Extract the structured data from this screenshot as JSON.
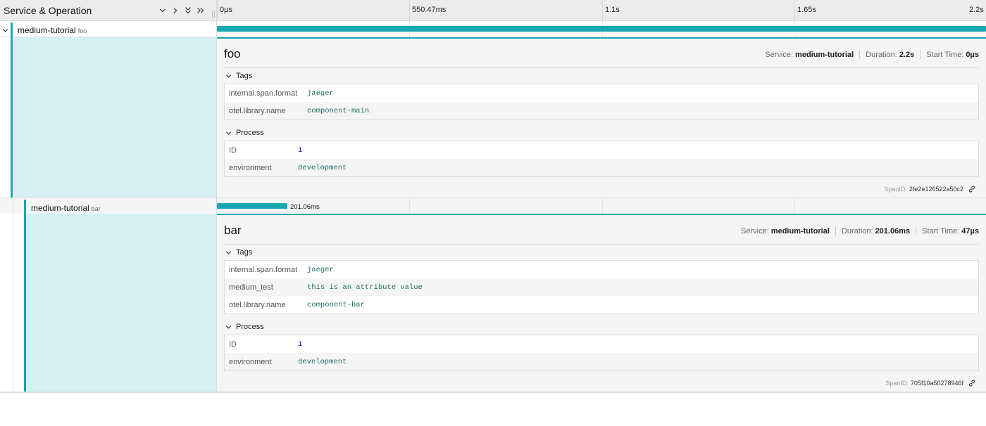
{
  "header": {
    "title": "Service & Operation",
    "controls": [
      "chevron-down-icon",
      "chevron-right-icon",
      "double-chevron-down-icon",
      "double-chevron-right-icon"
    ],
    "ticks": [
      "0µs",
      "550.47ms",
      "1.1s",
      "1.65s",
      "2.2s"
    ]
  },
  "spans": [
    {
      "service": "medium-tutorial",
      "operation": "foo",
      "duration_label": "",
      "bar_start_fraction": 0,
      "bar_width_fraction": 1,
      "detail": {
        "title": "foo",
        "service_label": "Service:",
        "service_value": "medium-tutorial",
        "duration_label": "Duration:",
        "duration_value": "2.2s",
        "start_label": "Start Time:",
        "start_value": "0µs",
        "tags_heading": "Tags",
        "tags": [
          {
            "key": "internal.span.format",
            "value": "jaeger"
          },
          {
            "key": "otel.library.name",
            "value": "component-main"
          }
        ],
        "process_heading": "Process",
        "process": [
          {
            "key": "ID",
            "value": "1"
          },
          {
            "key": "environment",
            "value": "development"
          }
        ],
        "spanid_label": "SpanID:",
        "spanid_value": "2fe2e126522a50c2"
      }
    },
    {
      "service": "medium-tutorial",
      "operation": "bar",
      "duration_label": "201.06ms",
      "bar_start_fraction": 0,
      "bar_width_fraction": 0.0913,
      "detail": {
        "title": "bar",
        "service_label": "Service:",
        "service_value": "medium-tutorial",
        "duration_label": "Duration:",
        "duration_value": "201.06ms",
        "start_label": "Start Time:",
        "start_value": "47µs",
        "tags_heading": "Tags",
        "tags": [
          {
            "key": "internal.span.format",
            "value": "jaeger"
          },
          {
            "key": "medium_test",
            "value": "this is an attribute value"
          },
          {
            "key": "otel.library.name",
            "value": "component-bar"
          }
        ],
        "process_heading": "Process",
        "process": [
          {
            "key": "ID",
            "value": "1"
          },
          {
            "key": "environment",
            "value": "development"
          }
        ],
        "spanid_label": "SpanID:",
        "spanid_value": "705f10a50278946f"
      }
    }
  ],
  "colors": {
    "accent": "#19a7b0",
    "detail_fill": "#d9f0f3"
  }
}
